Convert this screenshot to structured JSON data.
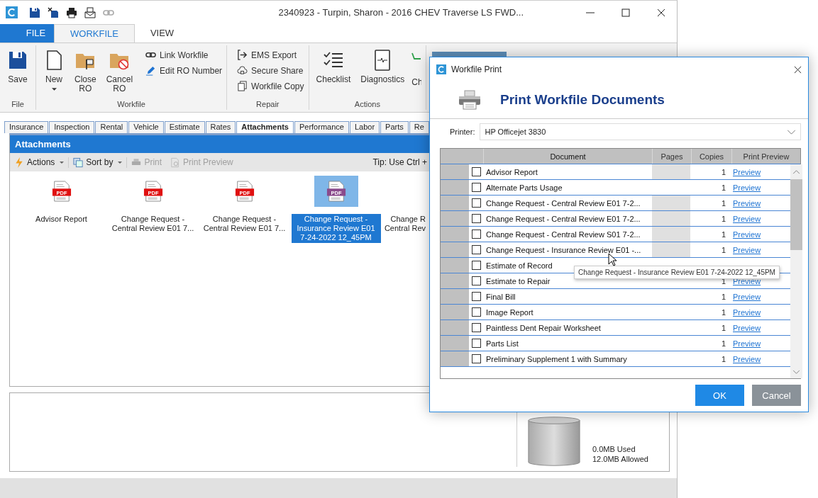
{
  "window": {
    "title": "2340923 - Turpin, Sharon - 2016 CHEV Traverse LS FWD..."
  },
  "ribbon_tabs": [
    {
      "label": "FILE",
      "kind": "backstage",
      "selected": false
    },
    {
      "label": "WORKFILE",
      "kind": "tab",
      "selected": true
    },
    {
      "label": "VIEW",
      "kind": "tab",
      "selected": false
    }
  ],
  "ribbon_groups": [
    {
      "label": "File",
      "buttons": [
        {
          "label": "Save",
          "kind": "large"
        }
      ]
    },
    {
      "label": "Workfile",
      "buttons": [
        {
          "label": "New",
          "kind": "dropdown"
        },
        {
          "label": "Close RO",
          "kind": "large"
        },
        {
          "label": "Cancel RO",
          "kind": "large"
        },
        {
          "label": "Link Workfile",
          "kind": "small"
        },
        {
          "label": "Edit RO Number",
          "kind": "small"
        }
      ]
    },
    {
      "label": "Repair",
      "buttons": [
        {
          "label": "EMS Export",
          "kind": "small"
        },
        {
          "label": "Secure Share",
          "kind": "small"
        },
        {
          "label": "Workfile Copy",
          "kind": "small"
        }
      ]
    },
    {
      "label": "Actions",
      "buttons": [
        {
          "label": "Checklist",
          "kind": "large"
        },
        {
          "label": "Diagnostics",
          "kind": "large"
        },
        {
          "label": "Ch",
          "kind": "cut"
        }
      ]
    }
  ],
  "pane_tabs": [
    {
      "label": "Insurance",
      "selected": false
    },
    {
      "label": "Inspection",
      "selected": false
    },
    {
      "label": "Rental",
      "selected": false
    },
    {
      "label": "Vehicle",
      "selected": false
    },
    {
      "label": "Estimate",
      "selected": false
    },
    {
      "label": "Rates",
      "selected": false
    },
    {
      "label": "Attachments",
      "selected": true
    },
    {
      "label": "Performance",
      "selected": false
    },
    {
      "label": "Labor",
      "selected": false
    },
    {
      "label": "Parts",
      "selected": false
    },
    {
      "label": "Re",
      "selected": false
    }
  ],
  "attachments": {
    "title": "Attachments",
    "toolbar": [
      {
        "label": "Actions",
        "kind": "menu",
        "disabled": false
      },
      {
        "label": "Sort by",
        "kind": "menu",
        "disabled": false
      },
      {
        "label": "Print",
        "kind": "button",
        "disabled": true
      },
      {
        "label": "Print Preview",
        "kind": "button",
        "disabled": true
      }
    ],
    "tip": "Tip: Use Ctrl +",
    "files": [
      {
        "name": "Advisor Report",
        "kind": "full",
        "badge": "PDF",
        "selected": false
      },
      {
        "name": "Change Request - Central Review E01 7...",
        "kind": "full",
        "badge": "PDF",
        "selected": false
      },
      {
        "name": "Change Request - Central Review E01 7...",
        "kind": "full",
        "badge": "PDF",
        "selected": false
      },
      {
        "name": "Change Request - Insurance Review E01 7-24-2022 12_45PM",
        "kind": "full",
        "badge": "PDF",
        "selected": true
      },
      {
        "name": "Change R Central Rev",
        "kind": "cut",
        "selected": false
      }
    ]
  },
  "storage": {
    "used": "0.0MB Used",
    "allowed": "12.0MB Allowed"
  },
  "dialog": {
    "title": "Workfile Print",
    "heading": "Print Workfile Documents",
    "printer_label": "Printer:",
    "printer": "HP Officejet 3830",
    "columns": [
      "Document",
      "Pages",
      "Copies",
      "Print Preview"
    ],
    "rows": [
      {
        "document": "Advisor Report",
        "checked": false,
        "pages_shaded": true,
        "copies": "1",
        "preview": "Preview"
      },
      {
        "document": "Alternate Parts Usage",
        "checked": false,
        "pages_shaded": false,
        "copies": "1",
        "preview": "Preview"
      },
      {
        "document": "Change Request - Central Review E01 7-2...",
        "checked": false,
        "pages_shaded": true,
        "copies": "1",
        "preview": "Preview"
      },
      {
        "document": "Change Request - Central Review E01 7-2...",
        "checked": false,
        "pages_shaded": true,
        "copies": "1",
        "preview": "Preview"
      },
      {
        "document": "Change Request - Central Review S01 7-2...",
        "checked": false,
        "pages_shaded": true,
        "copies": "1",
        "preview": "Preview"
      },
      {
        "document": "Change Request - Insurance Review E01 -...",
        "checked": false,
        "pages_shaded": true,
        "copies": "1",
        "preview": "Preview"
      },
      {
        "document": "Estimate of Record",
        "checked": false,
        "pages_shaded": false
      },
      {
        "document": "Estimate to Repair",
        "checked": false,
        "pages_shaded": false,
        "copies": "1",
        "preview": "Preview"
      },
      {
        "document": "Final Bill",
        "checked": false,
        "pages_shaded": false,
        "copies": "1",
        "preview": "Preview"
      },
      {
        "document": "Image Report",
        "checked": false,
        "pages_shaded": false,
        "copies": "1",
        "preview": "Preview"
      },
      {
        "document": "Paintless Dent Repair Worksheet",
        "checked": false,
        "pages_shaded": false,
        "copies": "1",
        "preview": "Preview"
      },
      {
        "document": "Parts List",
        "checked": false,
        "pages_shaded": false,
        "copies": "1",
        "preview": "Preview"
      },
      {
        "document": "Preliminary Supplement 1 with Summary",
        "checked": false,
        "pages_shaded": false,
        "copies": "1",
        "preview": "Preview"
      }
    ],
    "tooltip": "Change Request - Insurance Review E01 7-24-2022 12_45PM",
    "buttons": [
      {
        "label": "OK",
        "kind": "primary"
      },
      {
        "label": "Cancel",
        "kind": "secondary"
      }
    ]
  }
}
